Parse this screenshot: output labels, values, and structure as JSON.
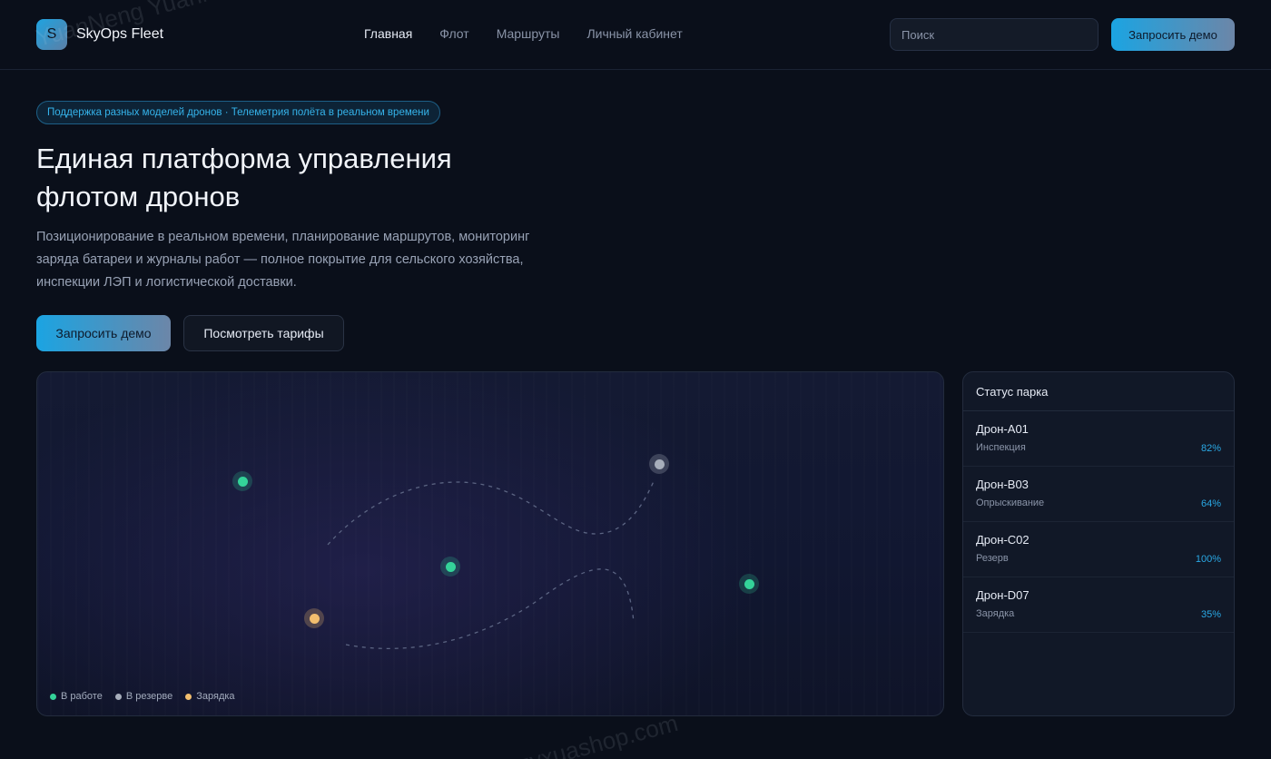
{
  "header": {
    "logo_letter": "S",
    "brand": "SkyOps Fleet",
    "nav": [
      {
        "label": "Главная",
        "active": true
      },
      {
        "label": "Флот",
        "active": false
      },
      {
        "label": "Маршруты",
        "active": false
      },
      {
        "label": "Личный кабинет",
        "active": false
      }
    ],
    "search_placeholder": "Поиск",
    "cta_label": "Запросить демо"
  },
  "hero": {
    "badge": "Поддержка разных моделей дронов · Телеметрия полёта в реальном времени",
    "title_line1": "Единая платформа управления",
    "title_line2": "флотом дронов",
    "description": "Позиционирование в реальном времени, планирование маршрутов, мониторинг заряда батареи и журналы работ — полное покрытие для сельского хозяйства, инспекции ЛЭП и логистической доставки.",
    "primary_label": "Запросить демо",
    "secondary_label": "Посмотреть тарифы"
  },
  "map": {
    "markers": [
      {
        "status": "active",
        "icon": "drone-marker-icon"
      },
      {
        "status": "reserve",
        "icon": "drone-marker-icon"
      },
      {
        "status": "active",
        "icon": "drone-marker-icon"
      },
      {
        "status": "active",
        "icon": "drone-marker-icon"
      },
      {
        "status": "charging",
        "icon": "drone-marker-icon"
      }
    ],
    "legend": [
      {
        "label": "В работе",
        "color": "#34d399"
      },
      {
        "label": "В резерве",
        "color": "#a7aebb"
      },
      {
        "label": "Зарядка",
        "color": "#f2be6e"
      }
    ]
  },
  "fleet_status": {
    "title": "Статус парка",
    "items": [
      {
        "name": "Дрон-A01",
        "task": "Инспекция",
        "battery": "82%"
      },
      {
        "name": "Дрон-B03",
        "task": "Опрыскивание",
        "battery": "64%"
      },
      {
        "name": "Дрон-C02",
        "task": "Резерв",
        "battery": "100%"
      },
      {
        "name": "Дрон-D07",
        "task": "Зарядка",
        "battery": "35%"
      }
    ]
  },
  "watermark": {
    "line1": "YuanNeng YuanMa · inzyxuashop.com",
    "line2": "inzyxuashop.com"
  },
  "colors": {
    "accent": "#1ba4e2",
    "active": "#34d399",
    "reserve": "#a7aebb",
    "charging": "#f2be6e",
    "background": "#0a0f1a"
  }
}
